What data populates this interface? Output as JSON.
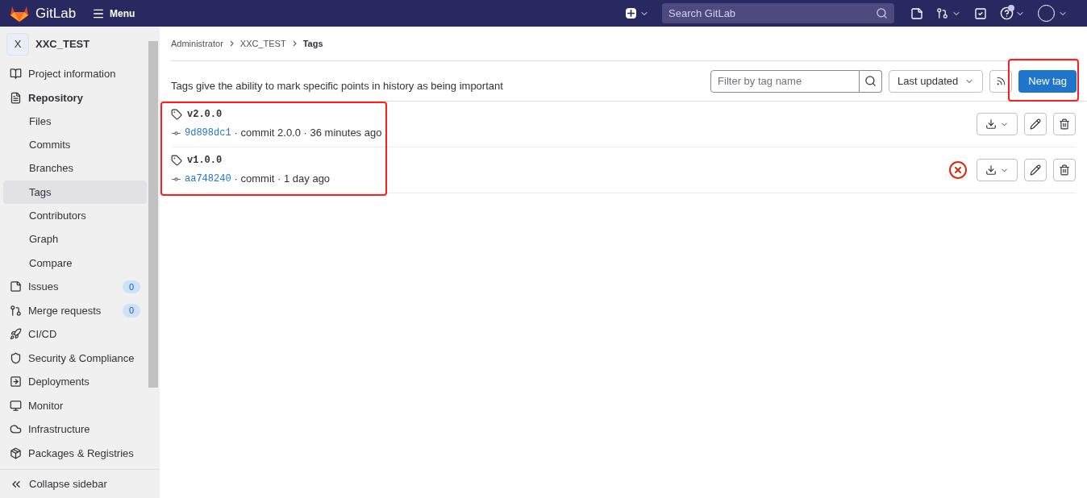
{
  "topbar": {
    "brand": "GitLab",
    "menu": "Menu",
    "search": {
      "placeholder": "Search GitLab"
    }
  },
  "sidebar": {
    "project_initial": "X",
    "project_name": "XXC_TEST",
    "items": [
      {
        "label": "Project information",
        "selected": false
      },
      {
        "label": "Repository",
        "selected": false,
        "children": [
          {
            "label": "Files",
            "selected": false
          },
          {
            "label": "Commits",
            "selected": false
          },
          {
            "label": "Branches",
            "selected": false
          },
          {
            "label": "Tags",
            "selected": true
          },
          {
            "label": "Contributors",
            "selected": false
          },
          {
            "label": "Graph",
            "selected": false
          },
          {
            "label": "Compare",
            "selected": false
          }
        ]
      },
      {
        "label": "Issues",
        "selected": false,
        "count": "0"
      },
      {
        "label": "Merge requests",
        "selected": false,
        "count": "0"
      },
      {
        "label": "CI/CD",
        "selected": false
      },
      {
        "label": "Security & Compliance",
        "selected": false
      },
      {
        "label": "Deployments",
        "selected": false
      },
      {
        "label": "Monitor",
        "selected": false
      },
      {
        "label": "Infrastructure",
        "selected": false
      },
      {
        "label": "Packages & Registries",
        "selected": false
      }
    ],
    "collapse": "Collapse sidebar"
  },
  "breadcrumb": [
    "Administrator",
    "XXC_TEST",
    "Tags"
  ],
  "description": "Tags give the ability to mark specific points in history as being important",
  "filter": {
    "placeholder": "Filter by tag name"
  },
  "sort": "Last updated",
  "new_tag": "New tag",
  "tags": [
    {
      "name": "v2.0.0",
      "sha": "9d898dc1",
      "message": "· commit 2.0.0 · 36 minutes ago",
      "pipeline_failed": false
    },
    {
      "name": "v1.0.0",
      "sha": "aa748240",
      "message": "· commit · 1 day ago",
      "pipeline_failed": true
    }
  ]
}
